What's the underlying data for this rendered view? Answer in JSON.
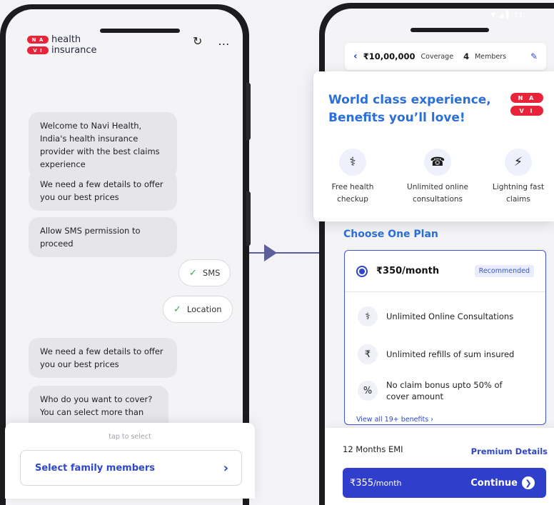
{
  "chat_app": {
    "brand_logo": "N A / V I",
    "brand_line1": "health",
    "brand_line2": "insurance",
    "icons": [
      "refresh-icon",
      "more-icon"
    ],
    "messages": [
      "Welcome to Navi Health, India's health insurance provider with the best claims experience",
      "We need a few details to offer you our best prices",
      "Allow SMS permission to proceed",
      "We need a few details to offer you our best prices",
      "Who do you want to cover? You can select more than one"
    ],
    "permission_chips": [
      "SMS",
      "Location"
    ],
    "sheet": {
      "hint": "tap to select",
      "select_label": "Select family members"
    }
  },
  "plan_app": {
    "status_time": "11:",
    "coverage": {
      "amount": "₹10,00,000",
      "amount_suffix": "Coverage",
      "members_count": "4",
      "members_label": "Members"
    },
    "benefits": {
      "title_line1": "World class experience,",
      "title_line2": "Benefits you’ll love!",
      "logo_top": "N A",
      "logo_bottom": "V I",
      "items": [
        {
          "line1": "Free health",
          "line2": "checkup",
          "icon": "health-checkup-icon"
        },
        {
          "line1": "Unlimited online",
          "line2": "consultations",
          "icon": "doctor-phone-icon"
        },
        {
          "line1": "Lightning fast",
          "line2": "claims",
          "icon": "fast-claims-icon"
        }
      ]
    },
    "choose_heading": "Choose One Plan",
    "plan": {
      "price": "₹350/month",
      "badge": "Recommended",
      "features": [
        {
          "line1": "Unlimited Online Consultations",
          "line2": "",
          "icon": "doctor-icon"
        },
        {
          "line1": "Unlimited refills of sum insured",
          "line2": "",
          "icon": "refill-icon"
        },
        {
          "line1": "No claim bonus upto 50% of",
          "line2": "cover amount",
          "icon": "bonus-icon"
        }
      ],
      "view_all": "View all 19+ benefits ›"
    },
    "footer": {
      "emi_label": "12 Months EMI",
      "premium_link": "Premium Details",
      "cta_price": "₹355",
      "cta_price_unit": "/month",
      "cta_label": "Continue"
    }
  }
}
